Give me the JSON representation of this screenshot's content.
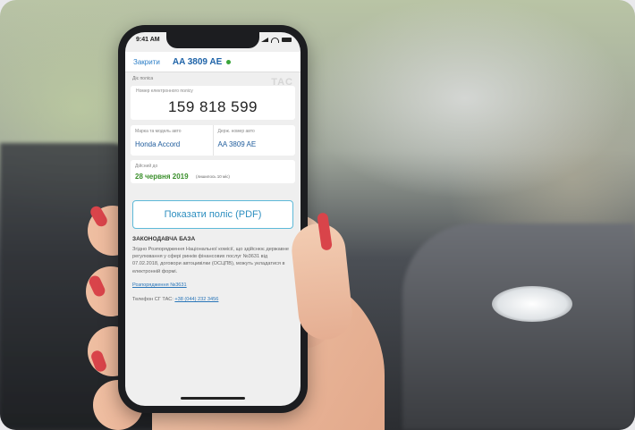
{
  "status": {
    "time": "9:41 AM"
  },
  "header": {
    "close_label": "Закрити",
    "plate": "AA 3809 AE"
  },
  "document": {
    "section_label": "Діє поліса",
    "logo": "TAC",
    "policy_label": "Номер електронного полісу",
    "policy_number": "159 818 599",
    "car_label": "Марка та модель авто",
    "car_value": "Honda Accord",
    "plate_label": "Держ. номер авто",
    "plate_value": "AA 3809 AE",
    "valid_label": "Дійсний до",
    "valid_date": "28 червня  2019",
    "valid_note": "(лишилось 10 міс)"
  },
  "actions": {
    "pdf_button": "Показати поліс (PDF)"
  },
  "legal": {
    "title": "ЗАКОНОДАВЧА БАЗА",
    "text": "Згідно Розпорядження Національної комісії, що здійснює державне регулювання у сфері ринків фінансових послуг №3631 від 07.02.2018, договори автоцивілки (ОСЦПВ), можуть укладатися в електронній формі.",
    "link": "Розпорядження №3631",
    "phone_label": "Телефон СГ ТАС:",
    "phone_number": "+38 (044) 232 3456"
  }
}
